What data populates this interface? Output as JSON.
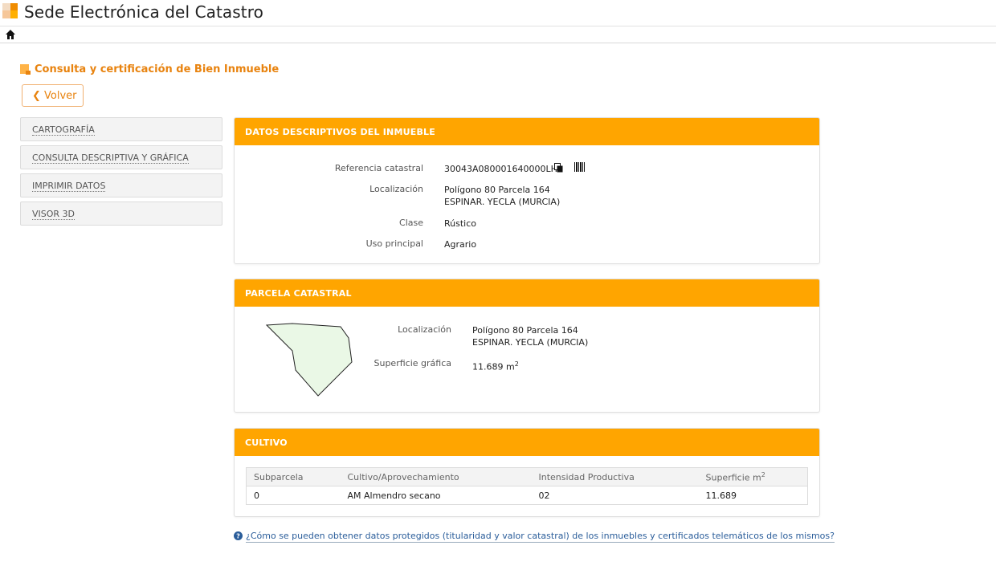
{
  "header": {
    "title": "Sede Electrónica del Catastro",
    "logo_icon": "catastro-logo-icon",
    "home_icon": "home-icon"
  },
  "page": {
    "title": "Consulta y certificación de Bien Inmueble",
    "back_label": "Volver"
  },
  "sidebar": {
    "items": [
      {
        "label": "CARTOGRAFÍA"
      },
      {
        "label": "CONSULTA DESCRIPTIVA Y GRÁFICA"
      },
      {
        "label": "IMPRIMIR DATOS"
      },
      {
        "label": "VISOR 3D"
      }
    ]
  },
  "datos": {
    "title": "DATOS DESCRIPTIVOS DEL INMUEBLE",
    "ref_label": "Referencia catastral",
    "ref_value": "30043A080001640000LH",
    "loc_label": "Localización",
    "loc_line1": "Polígono 80 Parcela 164",
    "loc_line2": "ESPINAR. YECLA (MURCIA)",
    "clase_label": "Clase",
    "clase_value": "Rústico",
    "uso_label": "Uso principal",
    "uso_value": "Agrario"
  },
  "parcela": {
    "title": "PARCELA CATASTRAL",
    "loc_label": "Localización",
    "loc_line1": "Polígono 80 Parcela 164",
    "loc_line2": "ESPINAR. YECLA (MURCIA)",
    "sup_label": "Superficie gráfica",
    "sup_value": "11.689 m",
    "sup_unit_sup": "2"
  },
  "cultivo": {
    "title": "CULTIVO",
    "headers": [
      "Subparcela",
      "Cultivo/Aprovechamiento",
      "Intensidad Productiva",
      "Superficie m"
    ],
    "header_sup": "2",
    "rows": [
      [
        "0",
        "AM Almendro secano",
        "02",
        "11.689"
      ]
    ]
  },
  "help": {
    "link": "¿Cómo se pueden obtener datos protegidos (titularidad y valor catastral) de los inmuebles y certificados telemáticos de los mismos?"
  },
  "colors": {
    "accent": "#ffa500",
    "title_orange": "#e8830f",
    "parcel_fill": "#eaf8e6",
    "link": "#2a5d9a"
  }
}
